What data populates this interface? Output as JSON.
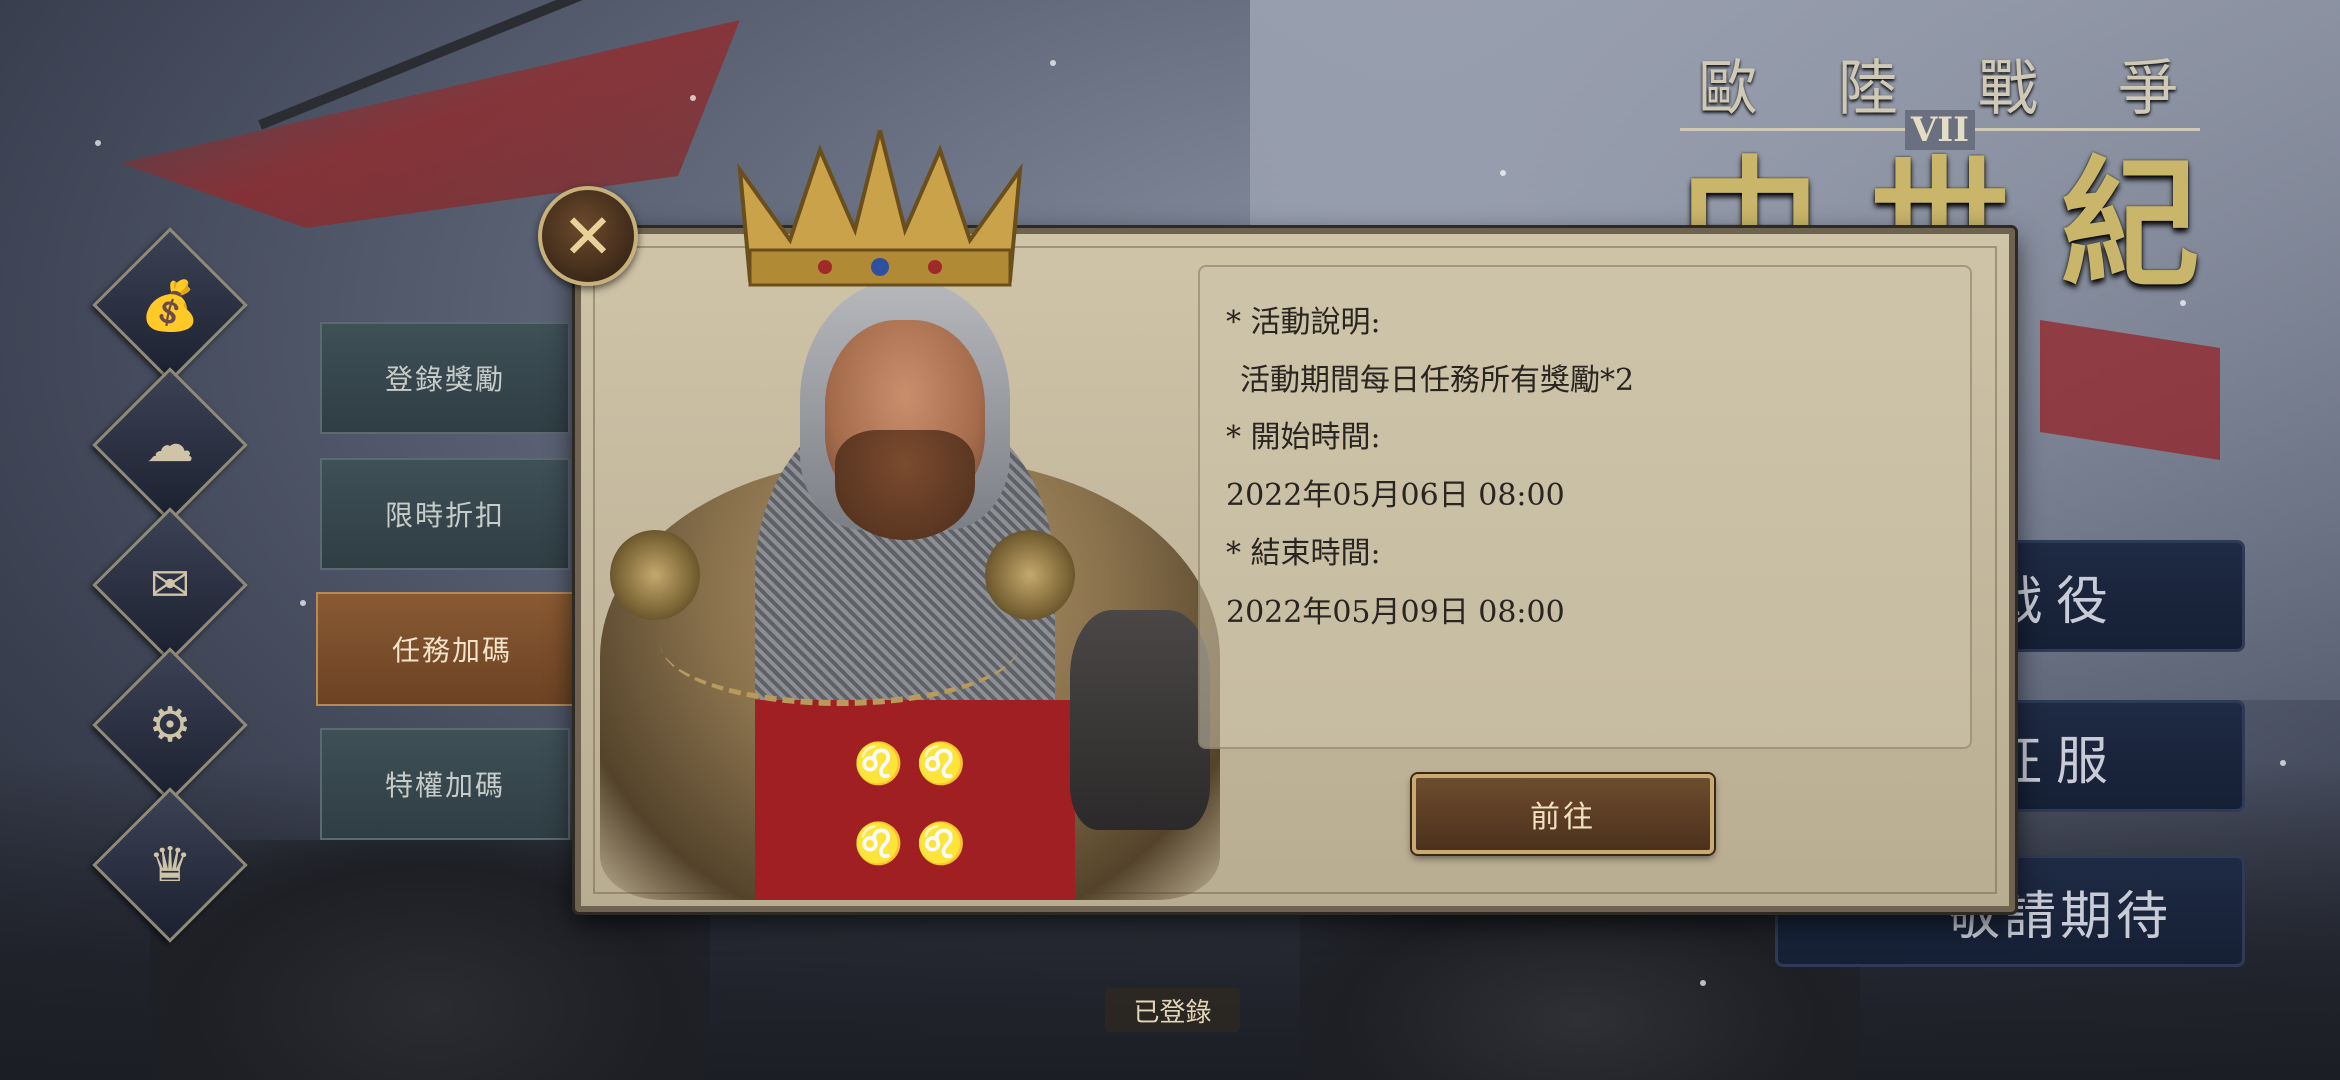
{
  "logo": {
    "subtitle_chars": [
      "歐",
      "陸",
      "戰",
      "爭"
    ],
    "roman_numeral": "VII",
    "main_chars": [
      "中",
      "世",
      "紀"
    ]
  },
  "right_menu": {
    "item1": "戰役",
    "item2": "征服",
    "item3": "敬請期待"
  },
  "sidebar_tabs": [
    {
      "label": "登錄獎勵",
      "active": false
    },
    {
      "label": "限時折扣",
      "active": false
    },
    {
      "label": "任務加碼",
      "active": true
    },
    {
      "label": "特權加碼",
      "active": false
    }
  ],
  "left_icons": [
    "money-bag-icon",
    "upload-cloud-icon",
    "mail-icon",
    "gear-icon",
    "crown-icon"
  ],
  "dialog": {
    "description_heading": "* 活動說明:",
    "description_text": "活動期間每日任務所有獎勵*2",
    "start_heading": "* 開始時間:",
    "start_time": "2022年05月06日 08:00",
    "end_heading": "* 結束時間:",
    "end_time": "2022年05月09日 08:00",
    "go_button": "前往"
  },
  "status": {
    "logged_in": "已登錄"
  },
  "colors": {
    "panel_bg": "#c4b99e",
    "active_tab": "#8a5a33",
    "inactive_tab": "#3f5057",
    "gold_accent": "#c7ab73"
  }
}
